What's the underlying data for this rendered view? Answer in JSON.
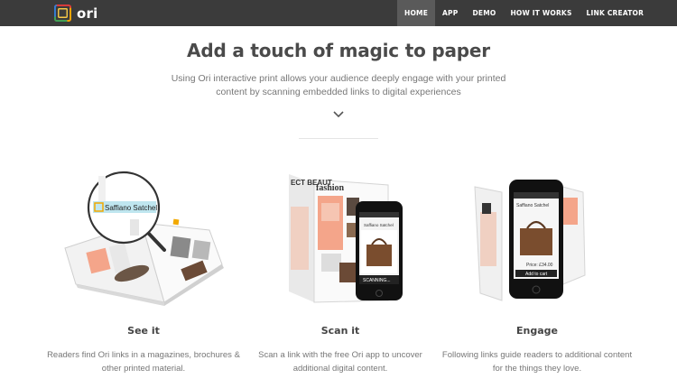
{
  "brand": {
    "name": "ori"
  },
  "nav": {
    "items": [
      {
        "label": "HOME",
        "active": true
      },
      {
        "label": "APP",
        "active": false
      },
      {
        "label": "DEMO",
        "active": false
      },
      {
        "label": "HOW IT WORKS",
        "active": false
      },
      {
        "label": "LINK CREATOR",
        "active": false
      }
    ]
  },
  "hero": {
    "title": "Add a touch of magic to paper",
    "subtitle": "Using Ori interactive print allows your audience deeply engage with your printed content by scanning embedded links to digital experiences",
    "scroll_icon": "chevron-down-icon"
  },
  "features": [
    {
      "title": "See it",
      "description": "Readers find Ori links in a magazines, brochures & other printed material.",
      "image_label": "Saffiano Satchel"
    },
    {
      "title": "Scan it",
      "description": "Scan a link with the free Ori app to uncover additional digital content.",
      "image_label": "fashion",
      "image_label_2": "ECT BEAUT",
      "phone_label": "Saffiano Satchel",
      "phone_status": "SCANNING..."
    },
    {
      "title": "Engage",
      "description": "Following links guide readers to additional content for the things they love.",
      "phone_label": "Saffiano Satchel",
      "price": "Price: £34.00",
      "button": "Add to cart"
    }
  ],
  "colors": {
    "nav_bg": "#3b3b3b",
    "nav_active": "#5a5a5a",
    "accent_peach": "#f4a58a",
    "text": "#4a4a4a"
  }
}
